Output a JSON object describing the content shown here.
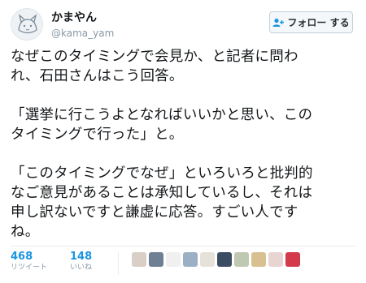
{
  "user": {
    "display_name": "かまやん",
    "handle": "@kama_yam",
    "avatar_icon": "cat-sketch-icon"
  },
  "follow_button": {
    "label": "フォロー する",
    "icon": "add-user-icon"
  },
  "tweet": {
    "paragraphs": [
      [
        "なぜこのタイミングで会見か、と記者に問わ",
        "れ、石田さんはこう回答。"
      ],
      [
        "「選挙に行こうよとなればいいかと思い、この",
        "タイミングで行った」と。"
      ],
      [
        "「このタイミングでなぜ」といろいろと批判的",
        "なご意見があることは承知しているし、それは",
        "申し訳ないですと謙虚に応答。すごい人です",
        "ね。"
      ]
    ]
  },
  "stats": {
    "retweets": {
      "value": "468",
      "label": "リツイート"
    },
    "likes": {
      "value": "148",
      "label": "いいね"
    }
  },
  "likers": {
    "colors": [
      "#d9cfc6",
      "#6f7f94",
      "#f0f0f0",
      "#9bb0c4",
      "#e6e2da",
      "#3b4d63",
      "#bfc8b0",
      "#d8c090",
      "#e8d4d0",
      "#d43a4a"
    ]
  }
}
